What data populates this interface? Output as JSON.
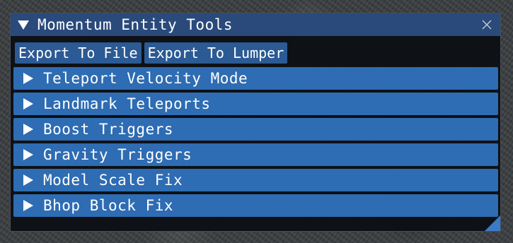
{
  "window": {
    "title": "Momentum Entity Tools",
    "collapse_icon": "triangle-down-icon",
    "close_icon": "close-icon"
  },
  "buttons": {
    "export_file": "Export To File",
    "export_lumper": "Export To Lumper"
  },
  "sections": [
    {
      "label": "Teleport Velocity Mode",
      "expanded": false
    },
    {
      "label": "Landmark Teleports",
      "expanded": false
    },
    {
      "label": "Boost Triggers",
      "expanded": false
    },
    {
      "label": "Gravity Triggers",
      "expanded": false
    },
    {
      "label": "Model Scale Fix",
      "expanded": false
    },
    {
      "label": "Bhop Block Fix",
      "expanded": false
    }
  ],
  "colors": {
    "titlebar": "#294a7a",
    "button": "#2b5a94",
    "header": "#2e6cb3",
    "window_bg": "#0a0d12",
    "text": "#ffffff"
  }
}
